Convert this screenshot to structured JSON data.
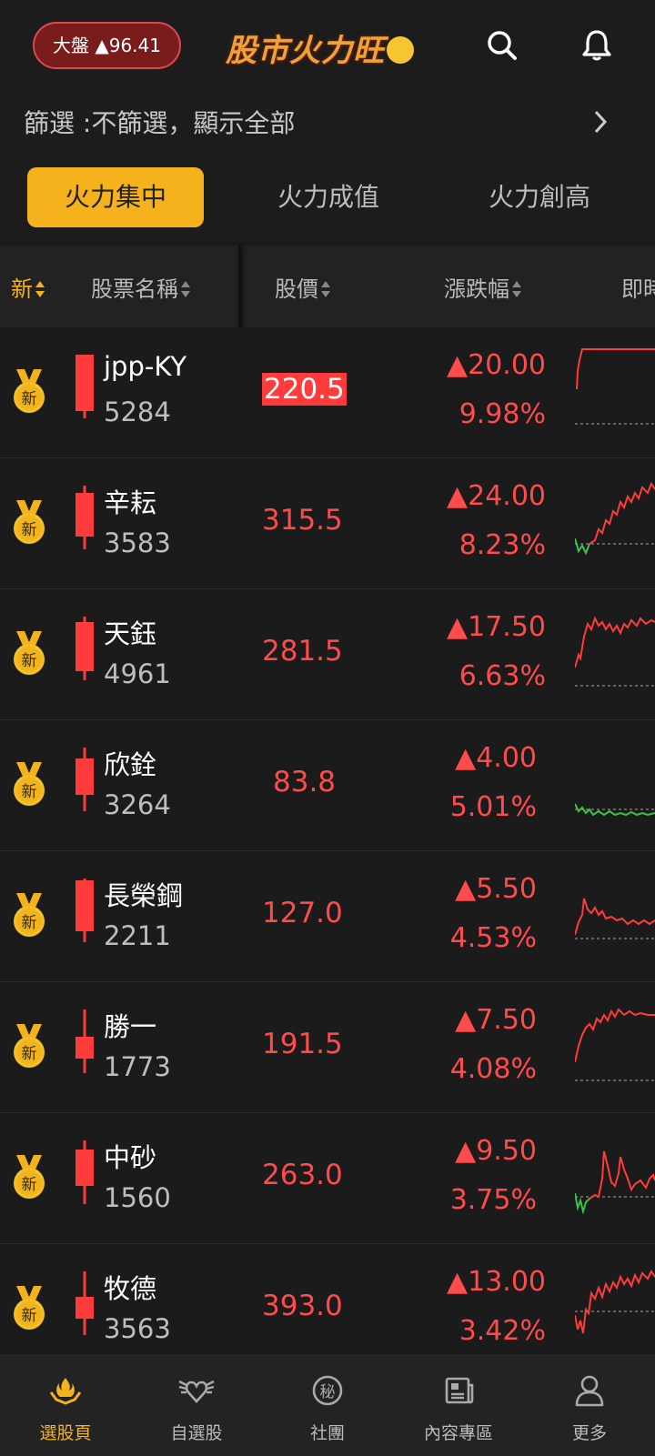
{
  "header": {
    "index_label": "大盤 ▲96.41",
    "title": "股市火力旺"
  },
  "filter": {
    "text": "篩選 :不篩選，顯示全部"
  },
  "tabs": [
    {
      "label": "火力集中",
      "active": true
    },
    {
      "label": "火力成值",
      "active": false
    },
    {
      "label": "火力創高",
      "active": false
    }
  ],
  "columns": {
    "new": "新",
    "name": "股票名稱",
    "price": "股價",
    "change": "漲跌幅",
    "realtime": "即時"
  },
  "stocks": [
    {
      "name": "jpp-KY",
      "code": "5284",
      "price": "220.5",
      "change": "▲20.00",
      "pct": "9.98%",
      "highlight": true
    },
    {
      "name": "辛耘",
      "code": "3583",
      "price": "315.5",
      "change": "▲24.00",
      "pct": "8.23%"
    },
    {
      "name": "天鈺",
      "code": "4961",
      "price": "281.5",
      "change": "▲17.50",
      "pct": "6.63%"
    },
    {
      "name": "欣銓",
      "code": "3264",
      "price": "83.8",
      "change": "▲4.00",
      "pct": "5.01%"
    },
    {
      "name": "長榮鋼",
      "code": "2211",
      "price": "127.0",
      "change": "▲5.50",
      "pct": "4.53%"
    },
    {
      "name": "勝一",
      "code": "1773",
      "price": "191.5",
      "change": "▲7.50",
      "pct": "4.08%"
    },
    {
      "name": "中砂",
      "code": "1560",
      "price": "263.0",
      "change": "▲9.50",
      "pct": "3.75%"
    },
    {
      "name": "牧德",
      "code": "3563",
      "price": "393.0",
      "change": "▲13.00",
      "pct": "3.42%"
    }
  ],
  "badge_text": "新",
  "nav": [
    {
      "label": "選股頁",
      "icon": "flame-hands-icon",
      "active": true
    },
    {
      "label": "自選股",
      "icon": "winged-heart-icon",
      "active": false
    },
    {
      "label": "社團",
      "icon": "secret-circle-icon",
      "active": false
    },
    {
      "label": "內容專區",
      "icon": "newspaper-icon",
      "active": false
    },
    {
      "label": "更多",
      "icon": "person-icon",
      "active": false
    }
  ],
  "colors": {
    "accent": "#f6b21c",
    "up": "#ff4b4b",
    "down": "#3cc24a",
    "background": "#1b1b1b"
  }
}
